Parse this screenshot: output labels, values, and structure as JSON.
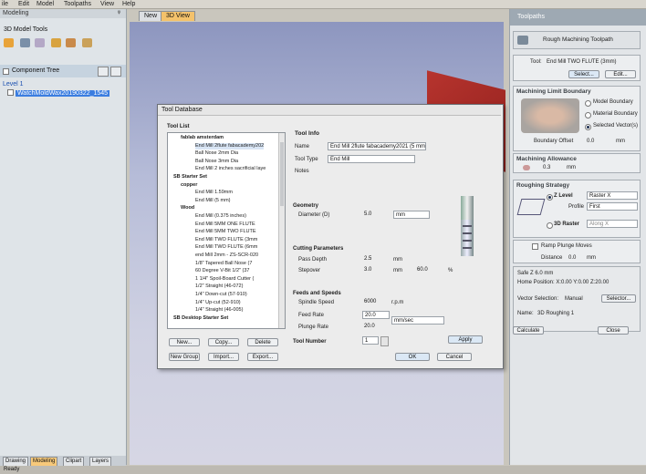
{
  "menu": [
    "ile",
    "Edit",
    "Model",
    "Toolpaths",
    "View",
    "Help"
  ],
  "left_panel": {
    "header": "Modeling",
    "pin": "ᵠ",
    "section_title": "3D Model Tools",
    "component_tree_title": "Component Tree",
    "tree": [
      {
        "label": "Level 1"
      },
      {
        "label": "WatchMoldWax20190322_1545"
      }
    ],
    "bottom_tabs": [
      "Drawing",
      "Modeling",
      "Clipart",
      "Layers"
    ]
  },
  "status_bar": {
    "text": "Ready"
  },
  "view_tabs": [
    "New",
    "3D View"
  ],
  "toolpaths_panel": {
    "header": "Toolpaths",
    "title": "Rough Machining Toolpath",
    "tool_label": "Tool:",
    "tool_value": "End Mill TWO FLUTE (3mm)",
    "select_btn": "Select...",
    "edit_btn": "Edit...",
    "boundary": {
      "title": "Machining Limit Boundary",
      "options": [
        "Model Boundary",
        "Material Boundary",
        "Selected Vector(s)"
      ],
      "selected_index": 2,
      "offset_label": "Boundary Offset",
      "offset_value": "0.0",
      "offset_unit": "mm"
    },
    "allowance": {
      "title": "Machining Allowance",
      "value": "0.3",
      "unit": "mm"
    },
    "strategy": {
      "title": "Roughing Strategy",
      "zlevel_label": "Z Level",
      "zlevel_option": "Raster X",
      "profile_label": "Profile",
      "profile_option": "First",
      "raster_label": "3D Raster",
      "raster_option": "Along X"
    },
    "ramp": {
      "label": "Ramp Plunge Moves",
      "distance_label": "Distance",
      "distance_value": "0.0",
      "distance_unit": "mm"
    },
    "safe_z": "Safe Z          6.0 mm",
    "home": "Home Position:  X:0.00 Y:0.00 Z:20.00",
    "vector_label": "Vector Selection:",
    "vector_value": "Manual",
    "selector_btn": "Selector...",
    "name_label": "Name:",
    "name_value": "3D Roughing 1",
    "calculate_btn": "Calculate",
    "close_btn": "Close"
  },
  "dialog": {
    "title": "Tool Database",
    "list_title": "Tool List",
    "tool_list": [
      {
        "text": "fablab amsterdam",
        "bold": true,
        "indent": 1
      },
      {
        "text": "End Mill 2flute fabacademy202",
        "bold": false,
        "indent": 3
      },
      {
        "text": "Ball Nose 2mm Dia",
        "bold": false,
        "indent": 3
      },
      {
        "text": "Ball Nose 3mm Dia",
        "bold": false,
        "indent": 3
      },
      {
        "text": "End Mill 2 inches sacrificial laye",
        "bold": false,
        "indent": 3
      },
      {
        "text": "SB Starter Set",
        "bold": true,
        "indent": 0
      },
      {
        "text": "copper",
        "bold": true,
        "indent": 1
      },
      {
        "text": "End Mill 1.59mm",
        "bold": false,
        "indent": 3
      },
      {
        "text": "End Mill (5 mm)",
        "bold": false,
        "indent": 3
      },
      {
        "text": "Wood",
        "bold": true,
        "indent": 1
      },
      {
        "text": "End Mill (0.375 inches)",
        "bold": false,
        "indent": 3
      },
      {
        "text": "End Mill 5MM ONE FLUTE",
        "bold": false,
        "indent": 3
      },
      {
        "text": "End Mill 5MM TWO FLUTE",
        "bold": false,
        "indent": 3
      },
      {
        "text": "End Mill TWO FLUTE (3mm",
        "bold": false,
        "indent": 3
      },
      {
        "text": "End Mill TWO FLUTE (6mm",
        "bold": false,
        "indent": 3
      },
      {
        "text": "end Mill 2mm - ZS-SCR-020",
        "bold": false,
        "indent": 3
      },
      {
        "text": "1/8\" Tapered Ball Nose (7",
        "bold": false,
        "indent": 3
      },
      {
        "text": "60 Degree V-Bit 1/2\" (37",
        "bold": false,
        "indent": 3
      },
      {
        "text": "1 1/4\" Spoil-Board Cutter (",
        "bold": false,
        "indent": 3
      },
      {
        "text": "1/2\" Straight  (46-072)",
        "bold": false,
        "indent": 3
      },
      {
        "text": "1/4\" Down-cut (57-910)",
        "bold": false,
        "indent": 3
      },
      {
        "text": "1/4\" Up-cut (52-910)",
        "bold": false,
        "indent": 3
      },
      {
        "text": "1/4\" Straight  (46-005)",
        "bold": false,
        "indent": 3
      },
      {
        "text": "SB Desktop Starter Set",
        "bold": true,
        "indent": 0
      }
    ],
    "buttons_row1": [
      "New...",
      "Copy...",
      "Delete"
    ],
    "buttons_row2": [
      "New Group",
      "Import...",
      "Export..."
    ],
    "tool_info": {
      "title": "Tool Info",
      "name_label": "Name",
      "name_value": "End Mill 2flute fabacademy2021 (5 mm)",
      "type_label": "Tool Type",
      "type_value": "End Mill",
      "notes_label": "Notes"
    },
    "geometry": {
      "title": "Geometry",
      "diameter_label": "Diameter (D)",
      "diameter_value": "5.0",
      "diameter_unit": "mm"
    },
    "cutting": {
      "title": "Cutting Parameters",
      "pass_label": "Pass Depth",
      "pass_value": "2.5",
      "pass_unit": "mm",
      "stepover_label": "Stepover",
      "stepover_value": "3.0",
      "stepover_unit": "mm",
      "stepover_pct": "60.0",
      "pct_symbol": "%"
    },
    "feeds": {
      "title": "Feeds and Speeds",
      "spindle_label": "Spindle Speed",
      "spindle_value": "6000",
      "spindle_unit": "r.p.m",
      "feed_label": "Feed Rate",
      "feed_value": "20.0",
      "feed_unit": "mm/sec",
      "plunge_label": "Plunge Rate",
      "plunge_value": "20.0"
    },
    "tool_number_label": "Tool Number",
    "tool_number_value": "1",
    "apply_btn": "Apply",
    "ok_btn": "OK",
    "cancel_btn": "Cancel"
  }
}
